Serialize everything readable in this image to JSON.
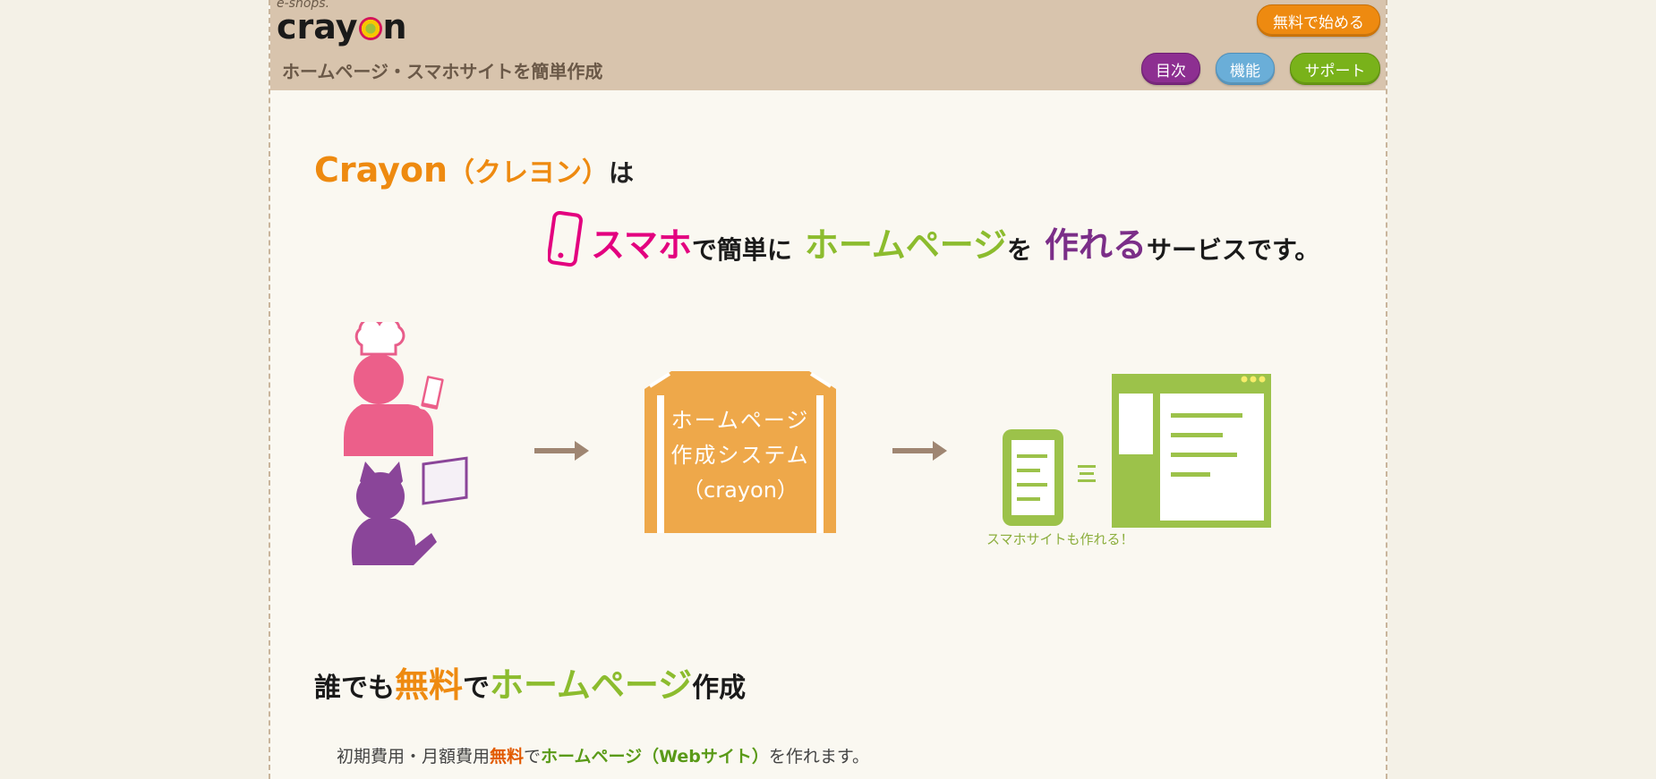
{
  "header": {
    "logo_sub": "e-shops.",
    "logo_pre": "cray",
    "logo_post": "n",
    "tagline": "ホームページ・スマホサイトを簡単作成",
    "start_button": "無料で始める",
    "nav": {
      "toc": "目次",
      "features": "機能",
      "support": "サポート"
    }
  },
  "intro": {
    "title_brand": "Crayon",
    "title_kana": "（クレヨン）",
    "title_wa": "は",
    "lead_1": "スマホ",
    "lead_2": "で簡単に",
    "lead_3": "ホームページ",
    "lead_4": "を",
    "lead_5": "作れる",
    "lead_6": "サービスです。"
  },
  "diagram": {
    "box_line1": "ホームページ",
    "box_line2": "作成システム",
    "box_line3": "（crayon）",
    "caption": "スマホサイトも作れる！"
  },
  "section": {
    "h_1": "誰でも",
    "h_2": "無料",
    "h_3": "で",
    "h_4": "ホームページ",
    "h_5": "作成",
    "p_1": "初期費用・月額費用",
    "p_2": "無料",
    "p_3": "で",
    "p_4": "ホームページ（Webサイト）",
    "p_5": "を作れます。"
  },
  "colors": {
    "accent_orange": "#ee8a10",
    "pink": "#e3007f",
    "green": "#8cbc2e",
    "purple": "#7b2e88",
    "header_bg": "#d8c4ad"
  }
}
